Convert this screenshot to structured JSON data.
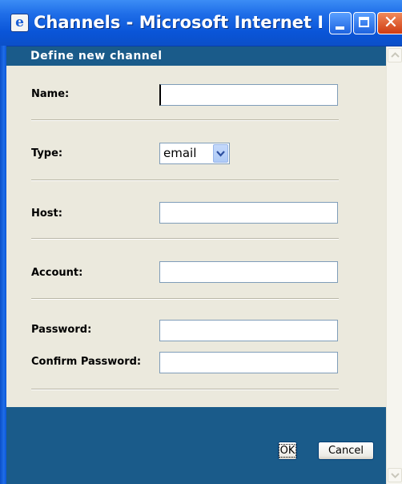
{
  "window": {
    "title": "Channels - Microsoft Internet Explor...",
    "icon": "ie-icon",
    "controls": [
      "minimize",
      "maximize",
      "close"
    ]
  },
  "panel": {
    "header": "Define new channel"
  },
  "form": {
    "name_label": "Name:",
    "name_value": "",
    "type_label": "Type:",
    "type_selected": "email",
    "host_label": "Host:",
    "host_value": "",
    "account_label": "Account:",
    "account_value": "",
    "password_label": "Password:",
    "password_value": "",
    "confirm_password_label": "Confirm Password:",
    "confirm_password_value": ""
  },
  "buttons": {
    "ok_label": "OK",
    "cancel_label": "Cancel"
  },
  "colors": {
    "panel_blue": "#1a5b8a",
    "content_bg": "#ebe9dd",
    "titlebar_blue": "#0a55d8"
  }
}
